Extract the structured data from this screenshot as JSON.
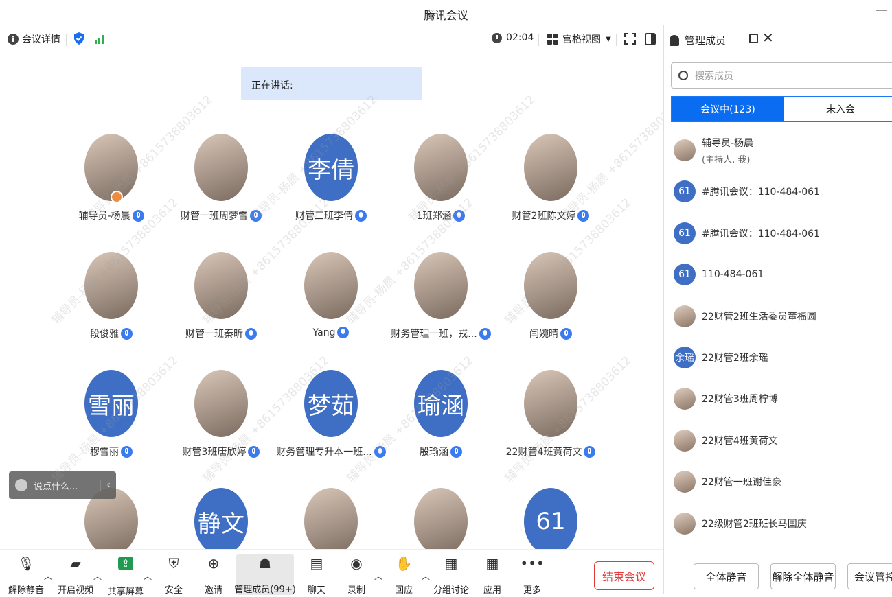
{
  "window": {
    "title": "腾讯会议",
    "minimize": "—"
  },
  "toolbar": {
    "details_label": "会议详情",
    "timer": "02:04",
    "view_label": "宫格视图"
  },
  "speaking_label": "正在讲话:",
  "participants": [
    {
      "name": "辅导员-杨晨",
      "avatar_text": "",
      "avatar_type": "image",
      "host": true
    },
    {
      "name": "财管一班周梦雪",
      "avatar_text": "",
      "avatar_type": "image"
    },
    {
      "name": "财管三班李倩",
      "avatar_text": "李倩",
      "avatar_type": "text"
    },
    {
      "name": "1班郑涵",
      "avatar_text": "",
      "avatar_type": "image"
    },
    {
      "name": "财管2班陈文婷",
      "avatar_text": "",
      "avatar_type": "image"
    },
    {
      "name": "段俊雅",
      "avatar_text": "",
      "avatar_type": "image"
    },
    {
      "name": "财管一班秦昕",
      "avatar_text": "",
      "avatar_type": "image"
    },
    {
      "name": "Yang",
      "avatar_text": "",
      "avatar_type": "image"
    },
    {
      "name": "财务管理一班，戎...",
      "avatar_text": "",
      "avatar_type": "image"
    },
    {
      "name": "闫婉晴",
      "avatar_text": "",
      "avatar_type": "image"
    },
    {
      "name": "穆雪丽",
      "avatar_text": "雪丽",
      "avatar_type": "text"
    },
    {
      "name": "财管3班唐欣婷",
      "avatar_text": "",
      "avatar_type": "image"
    },
    {
      "name": "财务管理专升本一班...",
      "avatar_text": "梦茹",
      "avatar_type": "text"
    },
    {
      "name": "殷瑜涵",
      "avatar_text": "瑜涵",
      "avatar_type": "text"
    },
    {
      "name": "22财管4班黄荷文",
      "avatar_text": "",
      "avatar_type": "image"
    },
    {
      "name": "",
      "avatar_text": "",
      "avatar_type": "image"
    },
    {
      "name": "",
      "avatar_text": "静文",
      "avatar_type": "text"
    },
    {
      "name": "",
      "avatar_text": "",
      "avatar_type": "image"
    },
    {
      "name": "",
      "avatar_text": "",
      "avatar_type": "image"
    },
    {
      "name": "",
      "avatar_text": "61",
      "avatar_type": "text"
    }
  ],
  "chat_placeholder": "说点什么...",
  "bottom": {
    "buttons": [
      {
        "label": "解除静音",
        "icon": "mic-muted-icon"
      },
      {
        "label": "开启视频",
        "icon": "camera-off-icon"
      },
      {
        "label": "共享屏幕",
        "icon": "share-screen-icon"
      },
      {
        "label": "安全",
        "icon": "shield-icon"
      },
      {
        "label": "邀请",
        "icon": "invite-icon"
      },
      {
        "label": "管理成员(99+)",
        "icon": "members-icon"
      },
      {
        "label": "聊天",
        "icon": "chat-icon"
      },
      {
        "label": "录制",
        "icon": "record-icon"
      },
      {
        "label": "回应",
        "icon": "reaction-icon"
      },
      {
        "label": "分组讨论",
        "icon": "breakout-icon"
      },
      {
        "label": "应用",
        "icon": "apps-icon"
      },
      {
        "label": "更多",
        "icon": "more-icon"
      }
    ],
    "end_label": "结束会议"
  },
  "panel": {
    "title": "管理成员",
    "search_placeholder": "搜索成员",
    "tab_in": "会议中(123)",
    "tab_out": "未入会",
    "members": [
      {
        "name": "辅导员-杨晨",
        "sub": "(主持人, 我)",
        "avatar_text": "",
        "avatar_type": "image"
      },
      {
        "name": "#腾讯会议：110-484-061",
        "sub": "",
        "avatar_text": "61",
        "avatar_type": "text"
      },
      {
        "name": "#腾讯会议：110-484-061",
        "sub": "",
        "avatar_text": "61",
        "avatar_type": "text"
      },
      {
        "name": "110-484-061",
        "sub": "",
        "avatar_text": "61",
        "avatar_type": "text"
      },
      {
        "name": "22财管2班生活委员董福圆",
        "sub": "",
        "avatar_text": "",
        "avatar_type": "image"
      },
      {
        "name": "22财管2班余瑶",
        "sub": "",
        "avatar_text": "余瑶",
        "avatar_type": "text"
      },
      {
        "name": "22财管3班周柠博",
        "sub": "",
        "avatar_text": "",
        "avatar_type": "image"
      },
      {
        "name": "22财管4班黄荷文",
        "sub": "",
        "avatar_text": "",
        "avatar_type": "image"
      },
      {
        "name": "22财管一班谢佳豪",
        "sub": "",
        "avatar_text": "",
        "avatar_type": "image"
      },
      {
        "name": "22级财管2班班长马国庆",
        "sub": "",
        "avatar_text": "",
        "avatar_type": "image"
      }
    ],
    "footer": {
      "mute_all": "全体静音",
      "unmute_all": "解除全体静音",
      "control": "会议管控"
    }
  },
  "watermark": "辅导员-杨晨 +8615738803612",
  "colors": {
    "accent": "#0a6cf0",
    "avatar_blue": "#3e6fc4",
    "end_red": "#e23b3b"
  }
}
